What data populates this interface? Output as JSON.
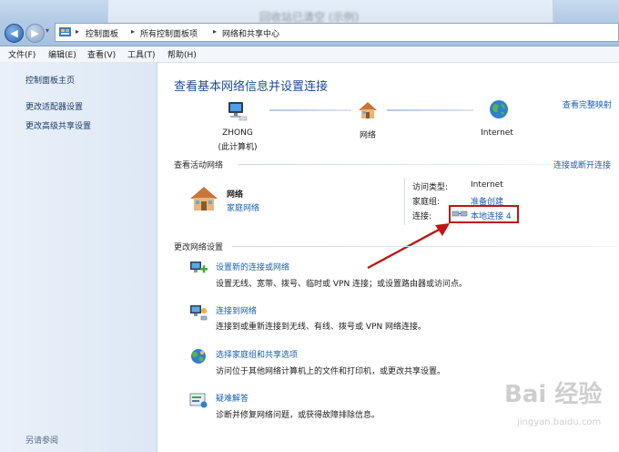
{
  "window": {
    "blurred_title": "回收站已清空 (示例)"
  },
  "address": {
    "crumbs": [
      "控制面板",
      "所有控制面板项",
      "网络和共享中心"
    ]
  },
  "menu": {
    "items": [
      "文件(F)",
      "编辑(E)",
      "查看(V)",
      "工具(T)",
      "帮助(H)"
    ]
  },
  "sidebar": {
    "home": "控制面板主页",
    "links": [
      "更改适配器设置",
      "更改高级共享设置"
    ],
    "see_also": "另请参阅"
  },
  "main": {
    "title": "查看基本网络信息并设置连接",
    "full_map_link": "查看完整映射",
    "map": {
      "computer_name": "ZHONG",
      "computer_sub": "(此计算机)",
      "network": "网络",
      "internet": "Internet"
    },
    "active": {
      "heading": "查看活动网络",
      "connect_link": "连接或断开连接",
      "network_name": "网络",
      "network_type": "家庭网络",
      "access_label": "访问类型:",
      "access_value": "Internet",
      "homegroup_label": "家庭组:",
      "homegroup_value": "准备创建",
      "connection_label": "连接:",
      "connection_value": "本地连接 4"
    },
    "change": {
      "heading": "更改网络设置",
      "tasks": [
        {
          "title": "设置新的连接或网络",
          "desc": "设置无线、宽带、拨号、临时或 VPN 连接；或设置路由器或访问点。",
          "icon": "new-connection-icon"
        },
        {
          "title": "连接到网络",
          "desc": "连接到或重新连接到无线、有线、拨号或 VPN 网络连接。",
          "icon": "connect-network-icon"
        },
        {
          "title": "选择家庭组和共享选项",
          "desc": "访问位于其他网络计算机上的文件和打印机，或更改共享设置。",
          "icon": "homegroup-icon"
        },
        {
          "title": "疑难解答",
          "desc": "诊断并修复网络问题，或获得故障排除信息。",
          "icon": "troubleshoot-icon"
        }
      ]
    }
  },
  "watermark": {
    "brand": "Bai 经验",
    "url": "jingyan.baidu.com"
  },
  "colors": {
    "link": "#1a5fb4",
    "title": "#1e4e8f",
    "annotation": "#c01515"
  }
}
